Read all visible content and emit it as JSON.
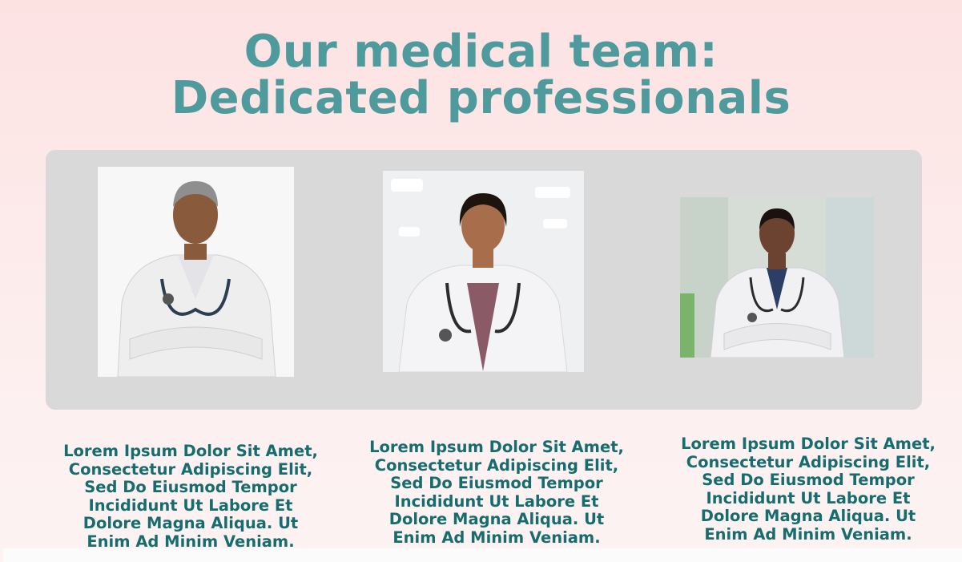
{
  "heading": {
    "line1": "Our medical team:",
    "line2": "Dedicated professionals"
  },
  "team": [
    {
      "photo_icon": "doctor-male-senior-photo",
      "description": "Lorem Ipsum Dolor Sit Amet, Consectetur Adipiscing Elit, Sed Do Eiusmod Tempor Incididunt Ut Labore Et Dolore Magna Aliqua. Ut Enim Ad Minim Veniam."
    },
    {
      "photo_icon": "doctor-female-photo",
      "description": "Lorem Ipsum Dolor Sit Amet, Consectetur Adipiscing Elit, Sed Do Eiusmod Tempor Incididunt Ut Labore Et Dolore Magna Aliqua. Ut Enim Ad Minim Veniam."
    },
    {
      "photo_icon": "doctor-male-young-photo",
      "description": "Lorem Ipsum Dolor Sit Amet, Consectetur Adipiscing Elit, Sed Do Eiusmod Tempor Incididunt Ut Labore Et Dolore Magna Aliqua. Ut Enim Ad Minim Veniam."
    }
  ],
  "colors": {
    "heading": "#4e9a9c",
    "description": "#166c6e",
    "panel": "#d9d9d9",
    "background": "#fde2e2"
  }
}
